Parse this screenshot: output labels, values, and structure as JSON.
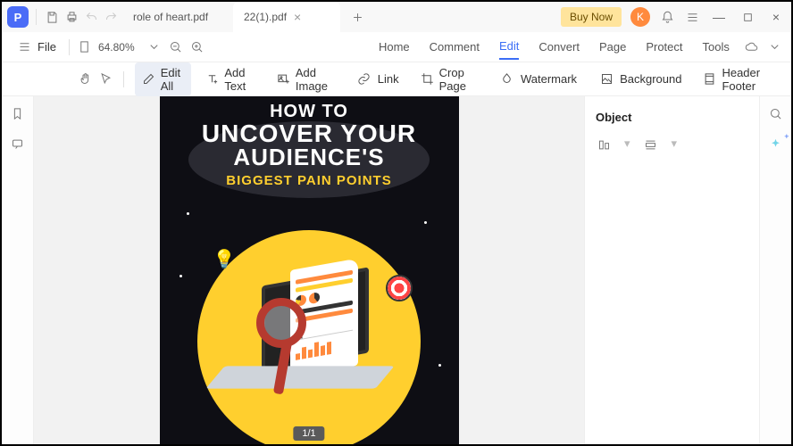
{
  "titlebar": {
    "tabs": [
      {
        "label": "role of heart.pdf",
        "active": false
      },
      {
        "label": "22(1).pdf",
        "active": true
      }
    ],
    "buy_now": "Buy Now",
    "avatar_initial": "K"
  },
  "menubar": {
    "file_label": "File",
    "zoom_value": "64.80%",
    "items": [
      "Home",
      "Comment",
      "Edit",
      "Convert",
      "Page",
      "Protect",
      "Tools"
    ],
    "active_item": "Edit"
  },
  "toolbar": {
    "edit_all": "Edit All",
    "add_text": "Add Text",
    "add_image": "Add Image",
    "link": "Link",
    "crop_page": "Crop Page",
    "watermark": "Watermark",
    "background": "Background",
    "header_footer": "Header Footer"
  },
  "right_panel": {
    "title": "Object"
  },
  "document": {
    "cover_lines": {
      "l1": "HOW TO",
      "l2": "UNCOVER YOUR",
      "l3": "AUDIENCE'S",
      "l4": "BIGGEST PAIN POINTS"
    }
  },
  "status": {
    "page_counter": "1/1"
  },
  "colors": {
    "accent": "#3b6ef6",
    "brand_bg": "#4a6cf7",
    "highlight": "#ffcf2e",
    "avatar": "#ff8a3d"
  }
}
